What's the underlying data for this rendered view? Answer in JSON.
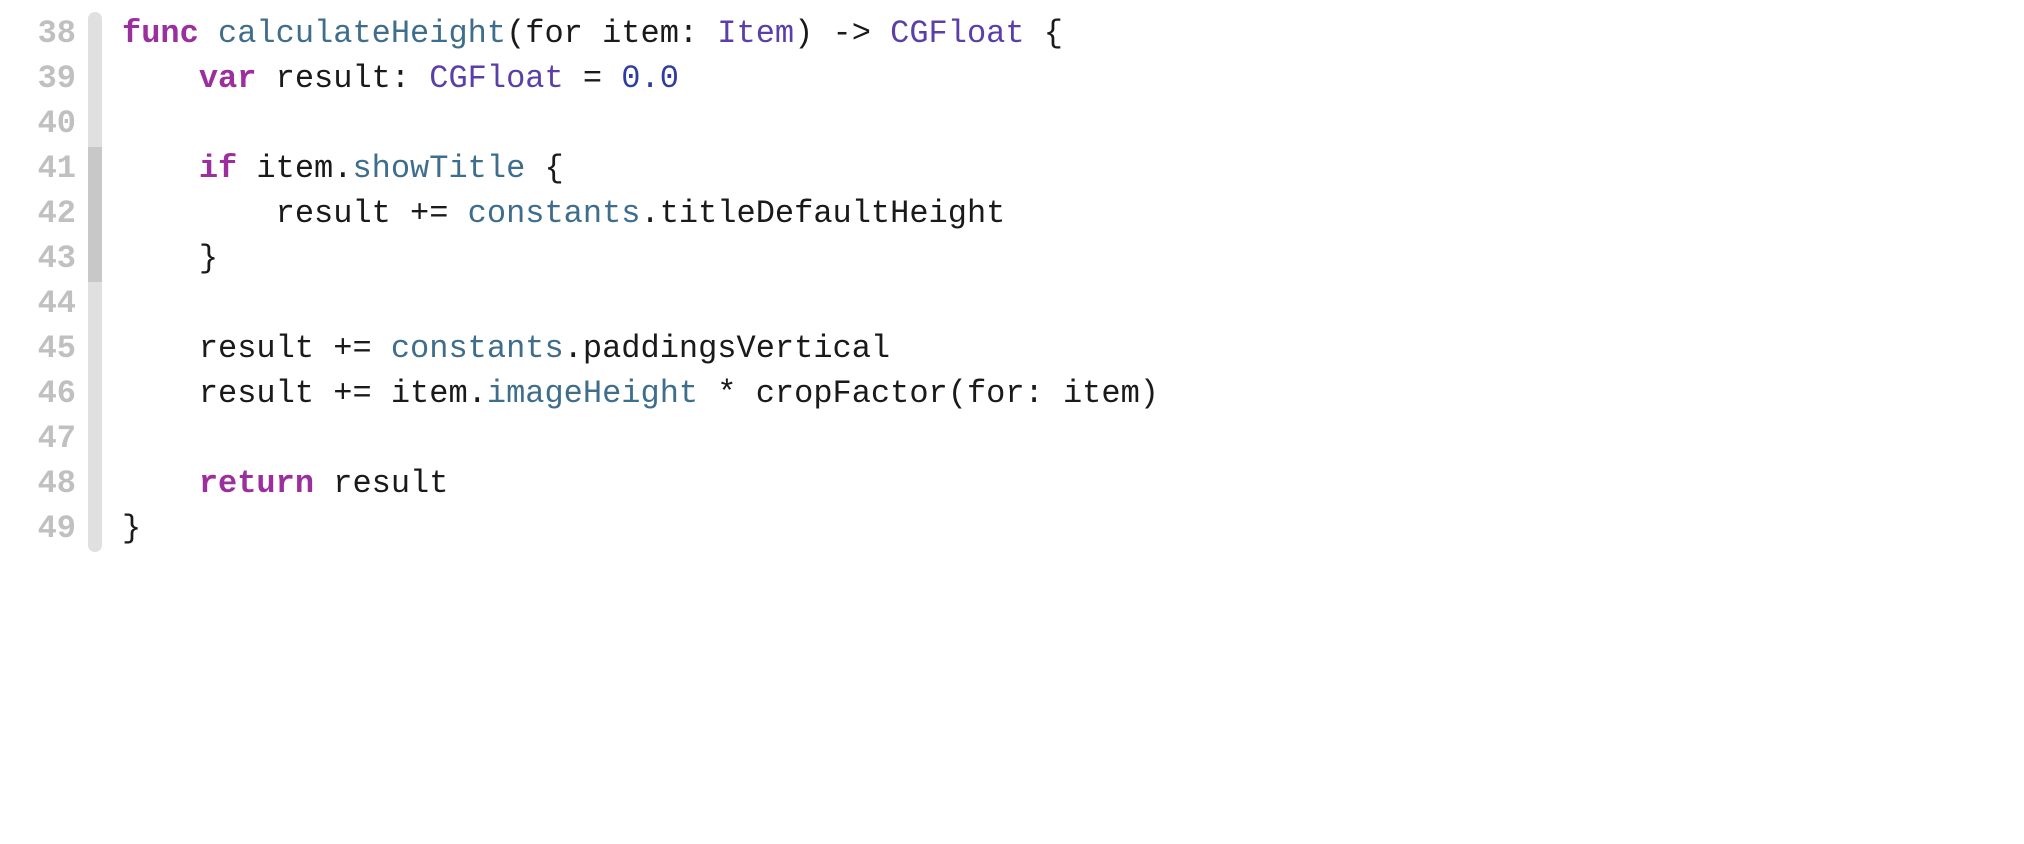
{
  "code": {
    "lines": [
      {
        "num": "38",
        "marker": "light",
        "tokens": [
          {
            "cls": "kw",
            "t": "func"
          },
          {
            "cls": "plain",
            "t": " "
          },
          {
            "cls": "fn",
            "t": "calculateHeight"
          },
          {
            "cls": "plain",
            "t": "("
          },
          {
            "cls": "plain",
            "t": "for"
          },
          {
            "cls": "plain",
            "t": " item: "
          },
          {
            "cls": "type",
            "t": "Item"
          },
          {
            "cls": "plain",
            "t": ") -> "
          },
          {
            "cls": "type",
            "t": "CGFloat"
          },
          {
            "cls": "plain",
            "t": " {"
          }
        ]
      },
      {
        "num": "39",
        "marker": "light",
        "tokens": [
          {
            "cls": "plain",
            "t": "    "
          },
          {
            "cls": "kw",
            "t": "var"
          },
          {
            "cls": "plain",
            "t": " result: "
          },
          {
            "cls": "type",
            "t": "CGFloat"
          },
          {
            "cls": "plain",
            "t": " = "
          },
          {
            "cls": "num",
            "t": "0.0"
          }
        ]
      },
      {
        "num": "40",
        "marker": "light",
        "tokens": []
      },
      {
        "num": "41",
        "marker": "dark",
        "tokens": [
          {
            "cls": "plain",
            "t": "    "
          },
          {
            "cls": "kw",
            "t": "if"
          },
          {
            "cls": "plain",
            "t": " item."
          },
          {
            "cls": "id",
            "t": "showTitle"
          },
          {
            "cls": "plain",
            "t": " {"
          }
        ]
      },
      {
        "num": "42",
        "marker": "dark",
        "tokens": [
          {
            "cls": "plain",
            "t": "        result += "
          },
          {
            "cls": "id",
            "t": "constants"
          },
          {
            "cls": "plain",
            "t": ".titleDefaultHeight"
          }
        ]
      },
      {
        "num": "43",
        "marker": "dark",
        "tokens": [
          {
            "cls": "plain",
            "t": "    }"
          }
        ]
      },
      {
        "num": "44",
        "marker": "light",
        "tokens": []
      },
      {
        "num": "45",
        "marker": "light",
        "tokens": [
          {
            "cls": "plain",
            "t": "    result += "
          },
          {
            "cls": "id",
            "t": "constants"
          },
          {
            "cls": "plain",
            "t": ".paddingsVertical"
          }
        ]
      },
      {
        "num": "46",
        "marker": "light",
        "tokens": [
          {
            "cls": "plain",
            "t": "    result += item."
          },
          {
            "cls": "id",
            "t": "imageHeight"
          },
          {
            "cls": "plain",
            "t": " * cropFactor(for: item)"
          }
        ]
      },
      {
        "num": "47",
        "marker": "light",
        "tokens": []
      },
      {
        "num": "48",
        "marker": "light",
        "tokens": [
          {
            "cls": "plain",
            "t": "    "
          },
          {
            "cls": "kw",
            "t": "return"
          },
          {
            "cls": "plain",
            "t": " result"
          }
        ]
      },
      {
        "num": "49",
        "marker": "light",
        "tokens": [
          {
            "cls": "plain",
            "t": "}"
          }
        ]
      }
    ]
  }
}
